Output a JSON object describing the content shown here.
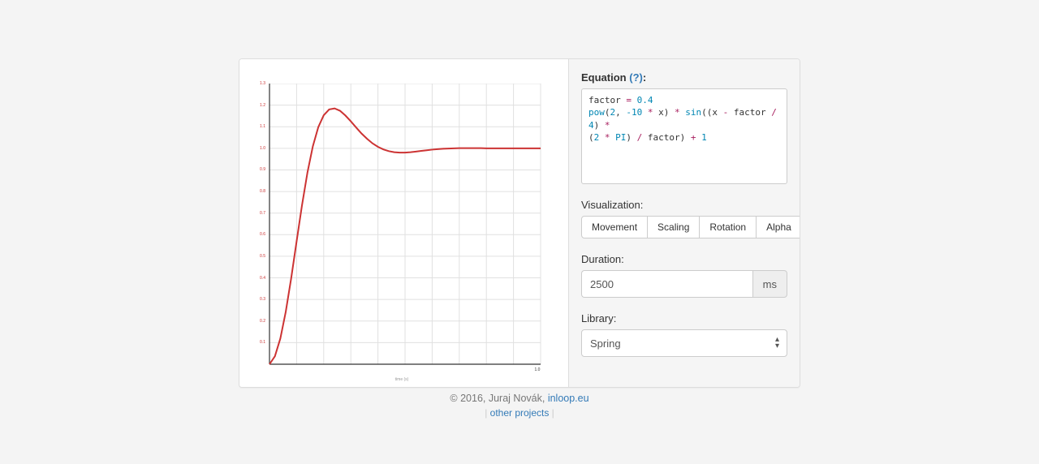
{
  "chart_data": {
    "type": "line",
    "title": "",
    "xlabel": "time (s)",
    "ylabel": "",
    "xlim": [
      0,
      1
    ],
    "ylim": [
      0,
      1.3
    ],
    "y_ticks": [
      "0.1",
      "0.2",
      "0.3",
      "0.4",
      "0.5",
      "0.6",
      "0.7",
      "0.8",
      "0.9",
      "1.0",
      "1.1",
      "1.2",
      "1.3"
    ],
    "x_tick_max": "1.0",
    "function": "factor = 0.4; pow(2, -10 * x) * sin((x - factor / 4) * (2 * PI) / factor) + 1",
    "samples": [
      [
        0.0,
        0.0
      ],
      [
        0.02,
        0.037
      ],
      [
        0.04,
        0.119
      ],
      [
        0.06,
        0.243
      ],
      [
        0.08,
        0.398
      ],
      [
        0.1,
        0.569
      ],
      [
        0.12,
        0.737
      ],
      [
        0.14,
        0.888
      ],
      [
        0.16,
        1.01
      ],
      [
        0.18,
        1.098
      ],
      [
        0.2,
        1.153
      ],
      [
        0.22,
        1.18
      ],
      [
        0.24,
        1.185
      ],
      [
        0.26,
        1.174
      ],
      [
        0.28,
        1.152
      ],
      [
        0.3,
        1.125
      ],
      [
        0.32,
        1.096
      ],
      [
        0.34,
        1.068
      ],
      [
        0.36,
        1.044
      ],
      [
        0.38,
        1.023
      ],
      [
        0.4,
        1.007
      ],
      [
        0.42,
        0.995
      ],
      [
        0.44,
        0.987
      ],
      [
        0.46,
        0.982
      ],
      [
        0.48,
        0.98
      ],
      [
        0.5,
        0.98
      ],
      [
        0.52,
        0.982
      ],
      [
        0.54,
        0.985
      ],
      [
        0.56,
        0.988
      ],
      [
        0.58,
        0.991
      ],
      [
        0.6,
        0.994
      ],
      [
        0.62,
        0.996
      ],
      [
        0.64,
        0.998
      ],
      [
        0.66,
        0.999
      ],
      [
        0.68,
        1.0
      ],
      [
        0.7,
        1.001
      ],
      [
        0.72,
        1.001
      ],
      [
        0.74,
        1.001
      ],
      [
        0.76,
        1.001
      ],
      [
        0.78,
        1.001
      ],
      [
        0.8,
        1.0
      ],
      [
        0.82,
        1.0
      ],
      [
        0.84,
        1.0
      ],
      [
        0.86,
        1.0
      ],
      [
        0.88,
        1.0
      ],
      [
        0.9,
        1.0
      ],
      [
        0.92,
        1.0
      ],
      [
        0.94,
        1.0
      ],
      [
        0.96,
        1.0
      ],
      [
        0.98,
        1.0
      ],
      [
        1.0,
        1.0
      ]
    ]
  },
  "editor": {
    "equation_label": "Equation",
    "help_symbol": "(?)",
    "colon": ":",
    "code_tokens": [
      {
        "t": "factor",
        "c": "tok-var"
      },
      {
        "t": " "
      },
      {
        "t": "=",
        "c": "tok-op"
      },
      {
        "t": " "
      },
      {
        "t": "0.4",
        "c": "tok-num"
      },
      {
        "br": true
      },
      {
        "t": "pow",
        "c": "tok-fn"
      },
      {
        "t": "("
      },
      {
        "t": "2",
        "c": "tok-num"
      },
      {
        "t": ", "
      },
      {
        "t": "-10",
        "c": "tok-num"
      },
      {
        "t": " "
      },
      {
        "t": "*",
        "c": "tok-op"
      },
      {
        "t": " x) "
      },
      {
        "t": "*",
        "c": "tok-op"
      },
      {
        "t": " "
      },
      {
        "t": "sin",
        "c": "tok-fn"
      },
      {
        "t": "((x "
      },
      {
        "t": "-",
        "c": "tok-op"
      },
      {
        "t": " factor "
      },
      {
        "t": "/",
        "c": "tok-op"
      },
      {
        "t": " "
      },
      {
        "t": "4",
        "c": "tok-num"
      },
      {
        "t": ") "
      },
      {
        "t": "*",
        "c": "tok-op"
      },
      {
        "br": true
      },
      {
        "t": "("
      },
      {
        "t": "2",
        "c": "tok-num"
      },
      {
        "t": " "
      },
      {
        "t": "*",
        "c": "tok-op"
      },
      {
        "t": " "
      },
      {
        "t": "PI",
        "c": "tok-const"
      },
      {
        "t": ") "
      },
      {
        "t": "/",
        "c": "tok-op"
      },
      {
        "t": " factor) "
      },
      {
        "t": "+",
        "c": "tok-op"
      },
      {
        "t": " "
      },
      {
        "t": "1",
        "c": "tok-num"
      }
    ]
  },
  "visualization": {
    "label": "Visualization:",
    "buttons": [
      "Movement",
      "Scaling",
      "Rotation",
      "Alpha"
    ]
  },
  "duration": {
    "label": "Duration:",
    "value": "2500",
    "unit": "ms"
  },
  "library": {
    "label": "Library:",
    "selected": "Spring"
  },
  "footer": {
    "copyright_prefix": "© 2016, Juraj Novák, ",
    "site_link": "inloop.eu",
    "other_projects": "other projects"
  }
}
